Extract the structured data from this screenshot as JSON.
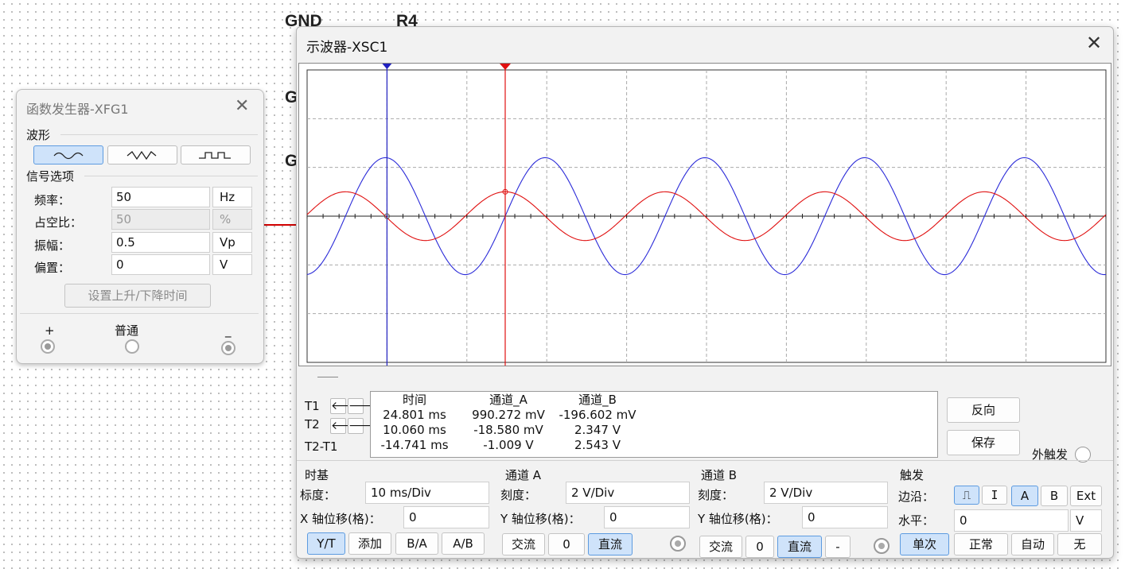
{
  "schematic": {
    "labels": [
      "GND",
      "R4",
      "G",
      "G"
    ]
  },
  "function_generator": {
    "title": "函数发生器-XFG1",
    "waveform_group": "波形",
    "signal_group": "信号选项",
    "waveforms": [
      "sine",
      "triangle",
      "square"
    ],
    "selected_waveform": "sine",
    "fields": [
      {
        "label": "频率：",
        "value": "50",
        "unit": "Hz",
        "disabled": false
      },
      {
        "label": "占空比：",
        "value": "50",
        "unit": "%",
        "disabled": true
      },
      {
        "label": "振幅：",
        "value": "0.5",
        "unit": "Vp",
        "disabled": false
      },
      {
        "label": "偏置：",
        "value": "0",
        "unit": "V",
        "disabled": false
      }
    ],
    "rise_fall_button": "设置上升/下降时间",
    "terminals": {
      "plus": "+",
      "common": "普通",
      "minus": "_"
    }
  },
  "oscilloscope": {
    "title": "示波器-XSC1",
    "colors": {
      "channel_a": "#e01010",
      "channel_b": "#2a2ad8",
      "grid": "#aaaaaa",
      "cursor1": "#2020c0",
      "cursor2": "#e01010"
    },
    "screen": {
      "time_per_div_ms": 10,
      "volts_per_div_A": 2,
      "volts_per_div_B": 2,
      "channel_a_amplitude_div": 0.5,
      "channel_b_amplitude_div": 1.2,
      "period_ms": 20,
      "cursor1_div": 1.0,
      "cursor2_div": 2.48
    },
    "cursor_labels": {
      "t1": "T1",
      "t2": "T2",
      "t2t1": "T2-T1"
    },
    "readout": {
      "headers": [
        "时间",
        "通道_A",
        "通道_B"
      ],
      "rows": [
        [
          "24.801 ms",
          "990.272 mV",
          "-196.602 mV"
        ],
        [
          "10.060 ms",
          "-18.580 mV",
          "2.347 V"
        ],
        [
          "-14.741 ms",
          "-1.009 V",
          "2.543 V"
        ]
      ]
    },
    "buttons": {
      "reverse": "反向",
      "save": "保存",
      "ext_trigger": "外触发"
    },
    "timebase": {
      "title": "时基",
      "scale_label": "标度：",
      "scale_value": "10 ms/Div",
      "xpos_label": "X 轴位移(格)：",
      "xpos_value": "0",
      "modes": [
        "Y/T",
        "添加",
        "B/A",
        "A/B"
      ],
      "selected_mode": "Y/T"
    },
    "channel_a": {
      "title": "通道 A",
      "scale_label": "刻度：",
      "scale_value": "2  V/Div",
      "ypos_label": "Y 轴位移(格)：",
      "ypos_value": "0",
      "coupling": [
        "交流",
        "0",
        "直流"
      ],
      "selected_coupling": "直流"
    },
    "channel_b": {
      "title": "通道 B",
      "scale_label": "刻度：",
      "scale_value": "2  V/Div",
      "ypos_label": "Y 轴位移(格)：",
      "ypos_value": "0",
      "coupling": [
        "交流",
        "0",
        "直流",
        "-"
      ],
      "selected_coupling": "直流"
    },
    "trigger": {
      "title": "触发",
      "edge_label": "边沿：",
      "sources": [
        "A",
        "B",
        "Ext"
      ],
      "selected_source": "A",
      "level_label": "水平：",
      "level_value": "0",
      "level_unit": "V",
      "modes": [
        "单次",
        "正常",
        "自动",
        "无"
      ],
      "selected_mode": "单次"
    }
  }
}
